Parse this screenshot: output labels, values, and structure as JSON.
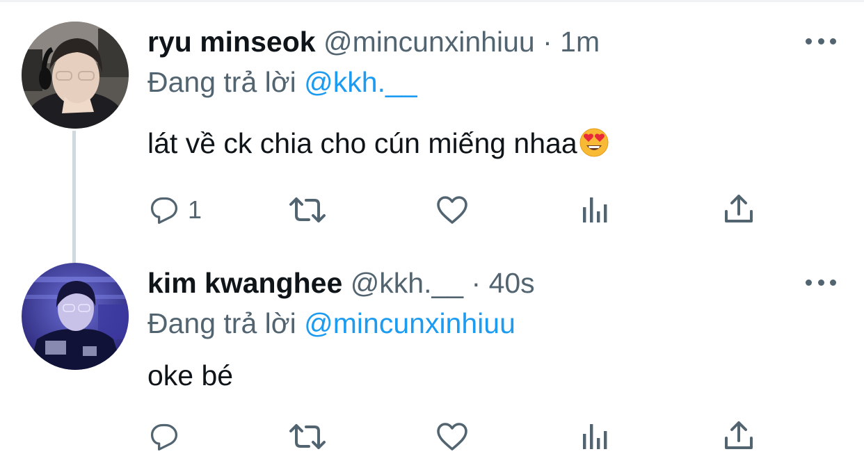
{
  "tweets": [
    {
      "display_name": "ryu minseok",
      "handle": "@mincunxinhiuu",
      "separator": "·",
      "time": "1m",
      "reply_prefix": "Đang trả lời",
      "reply_to": "@kkh.__",
      "text": "lát về ck chia cho cún miếng nhaa",
      "emoji": "smiling-face-with-heart-eyes",
      "actions": {
        "reply_count": "1",
        "retweet_count": "",
        "like_count": ""
      },
      "avatar": "avatar-gamer-headset"
    },
    {
      "display_name": "kim kwanghee",
      "handle": "@kkh.__",
      "separator": "·",
      "time": "40s",
      "reply_prefix": "Đang trả lời",
      "reply_to": "@mincunxinhiuu",
      "text": "oke bé",
      "actions": {
        "reply_count": "",
        "retweet_count": "",
        "like_count": ""
      },
      "avatar": "avatar-esports-jersey"
    }
  ],
  "colors": {
    "text": "#0f1419",
    "secondary": "#536471",
    "link": "#1d9bf0",
    "thread_line": "#cfd9de"
  }
}
